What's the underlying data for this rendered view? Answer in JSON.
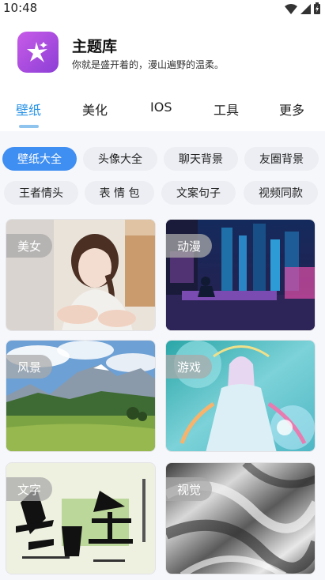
{
  "status_bar": {
    "time": "10:48"
  },
  "header": {
    "title": "主题库",
    "subtitle": "你就是盛开着的，漫山遍野的温柔。"
  },
  "tabs": [
    {
      "label": "壁纸",
      "active": true
    },
    {
      "label": "美化",
      "active": false
    },
    {
      "label": "IOS",
      "active": false
    },
    {
      "label": "工具",
      "active": false
    },
    {
      "label": "更多",
      "active": false
    }
  ],
  "chips": [
    {
      "label": "壁纸大全",
      "active": true
    },
    {
      "label": "头像大全",
      "active": false
    },
    {
      "label": "聊天背景",
      "active": false
    },
    {
      "label": "友圈背景",
      "active": false
    },
    {
      "label": "王者情头",
      "active": false
    },
    {
      "label": "表 情 包",
      "active": false
    },
    {
      "label": "文案句子",
      "active": false
    },
    {
      "label": "视频同款",
      "active": false
    }
  ],
  "cards": [
    {
      "label": "美女"
    },
    {
      "label": "动漫"
    },
    {
      "label": "风景"
    },
    {
      "label": "游戏"
    },
    {
      "label": "文字"
    },
    {
      "label": "视觉"
    }
  ],
  "colors": {
    "accent": "#2a93e6",
    "chip_active": "#3f8ef2",
    "icon": "#b84fe2"
  }
}
